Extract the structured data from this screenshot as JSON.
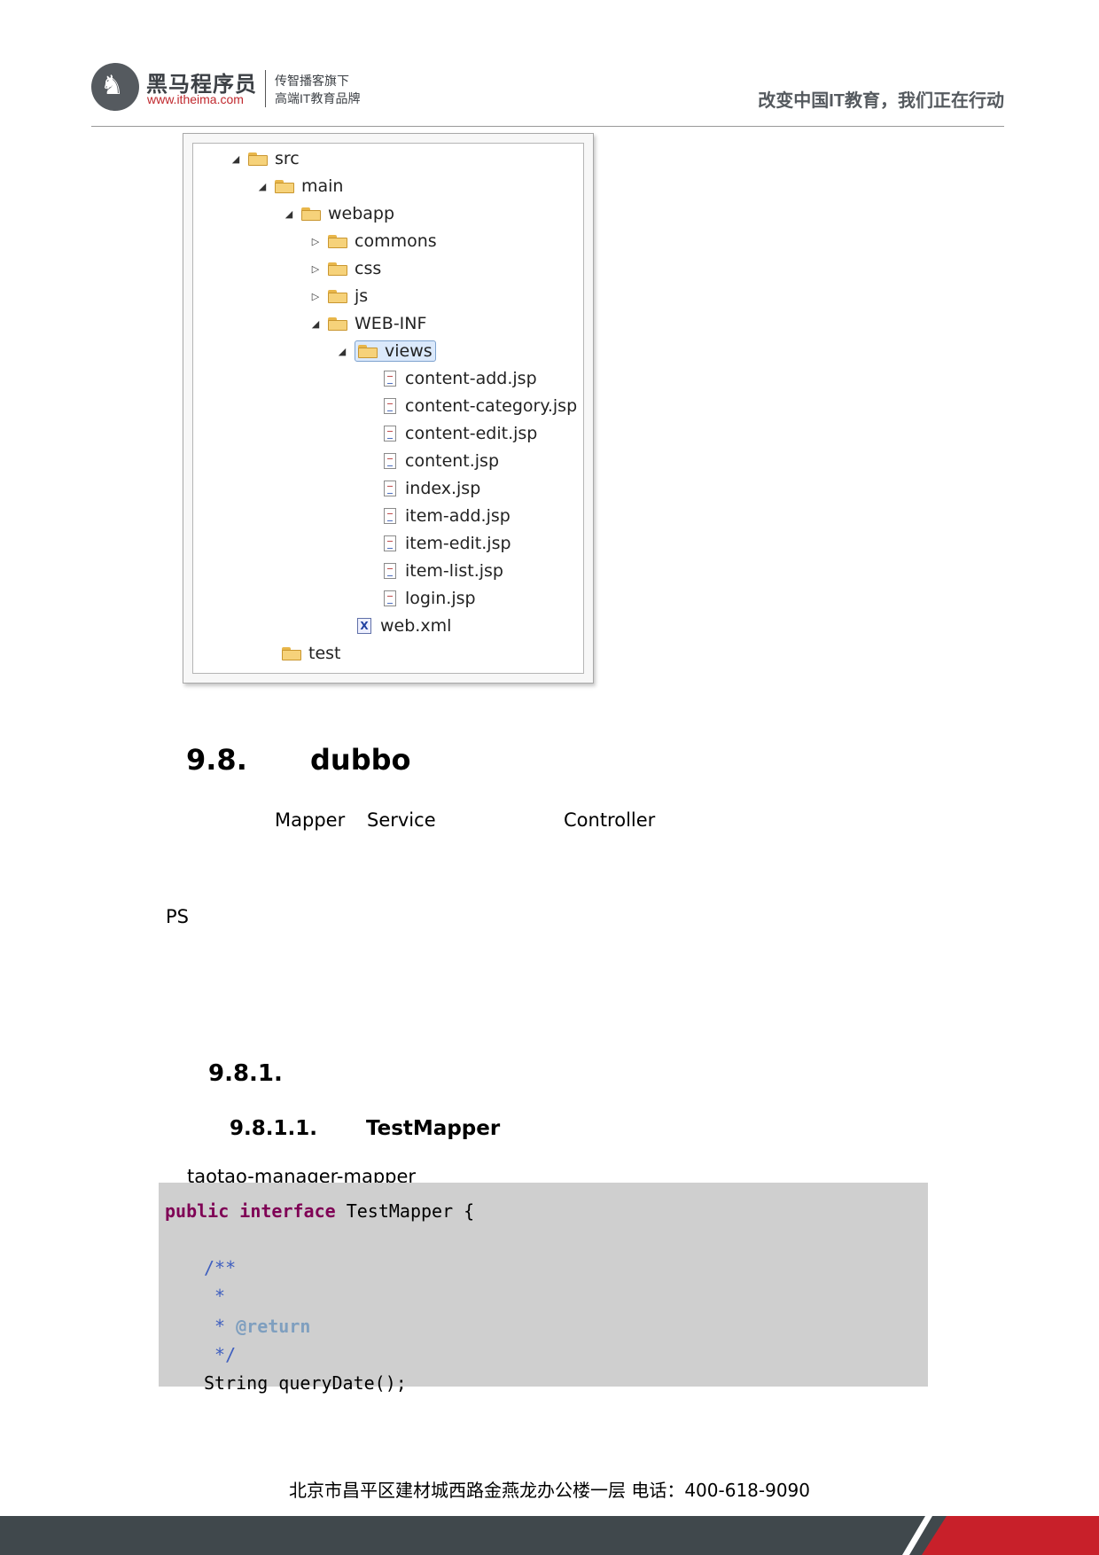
{
  "header": {
    "brand_name": "黑马程序员",
    "brand_url": "www.itheima.com",
    "tagline_1": "传智播客旗下",
    "tagline_2": "高端IT教育品牌",
    "slogan": "改变中国IT教育，我们正在行动"
  },
  "tree": [
    {
      "label": "src",
      "type": "folder",
      "toggle": "expanded"
    },
    {
      "label": "main",
      "type": "folder",
      "toggle": "expanded"
    },
    {
      "label": "webapp",
      "type": "folder",
      "toggle": "expanded"
    },
    {
      "label": "commons",
      "type": "folder",
      "toggle": "collapsed"
    },
    {
      "label": "css",
      "type": "folder",
      "toggle": "collapsed"
    },
    {
      "label": "js",
      "type": "folder",
      "toggle": "collapsed"
    },
    {
      "label": "WEB-INF",
      "type": "folder",
      "toggle": "expanded"
    },
    {
      "label": "views",
      "type": "folder",
      "toggle": "expanded",
      "selected": true
    },
    {
      "label": "content-add.jsp",
      "type": "jsp"
    },
    {
      "label": "content-category.jsp",
      "type": "jsp"
    },
    {
      "label": "content-edit.jsp",
      "type": "jsp"
    },
    {
      "label": "content.jsp",
      "type": "jsp"
    },
    {
      "label": "index.jsp",
      "type": "jsp"
    },
    {
      "label": "item-add.jsp",
      "type": "jsp"
    },
    {
      "label": "item-edit.jsp",
      "type": "jsp"
    },
    {
      "label": "item-list.jsp",
      "type": "jsp"
    },
    {
      "label": "login.jsp",
      "type": "jsp"
    },
    {
      "label": "web.xml",
      "type": "xml"
    },
    {
      "label": "test",
      "type": "folder"
    }
  ],
  "section": {
    "number": "9.8.",
    "title": "dubbo",
    "line_mapper": "Mapper",
    "line_service": "Service",
    "line_controller": "Controller",
    "ps": "PS"
  },
  "subsection": {
    "number": "9.8.1."
  },
  "subsubsection": {
    "number": "9.8.1.1.",
    "title": "TestMapper",
    "module": "taotao-manager-mapper"
  },
  "code": {
    "l1_kw1": "public",
    "l1_kw2": "interface",
    "l1_rest": " TestMapper {",
    "l3": "/**",
    "l4": " *",
    "l5_star": " * ",
    "l5_tag": "@return",
    "l6": " */",
    "l7": "String queryDate();"
  },
  "footer": {
    "address": "北京市昌平区建材城西路金燕龙办公楼一层   电话：400-618-9090"
  }
}
